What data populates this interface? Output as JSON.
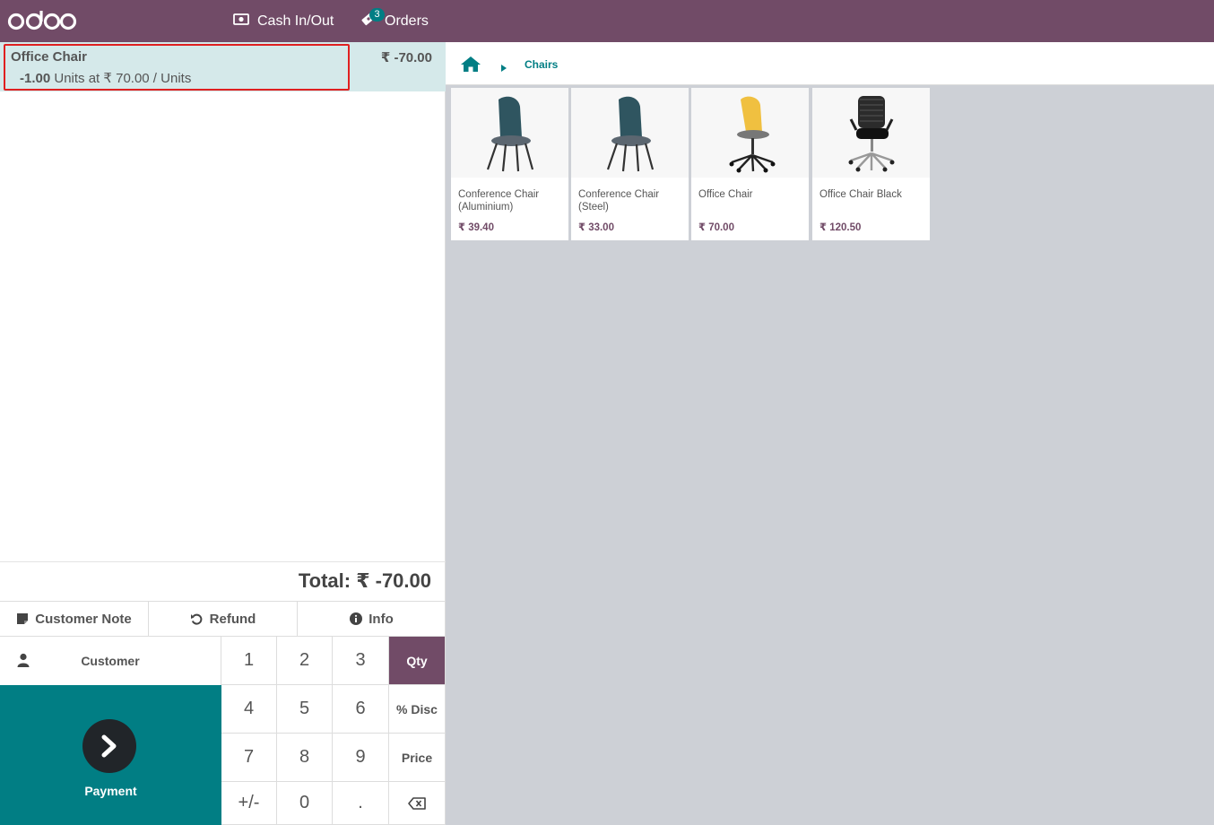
{
  "topbar": {
    "logo_text": "odoo",
    "cash_label": "Cash In/Out",
    "orders_label": "Orders",
    "orders_badge": "3"
  },
  "orderline": {
    "name": "Office Chair",
    "price": "₹ -70.00",
    "qty": "-1.00",
    "detail": "Units at ₹ 70.00 / Units"
  },
  "total": "Total: ₹ -70.00",
  "controls": {
    "customer_note": "Customer Note",
    "refund": "Refund",
    "info": "Info"
  },
  "customer_label": "Customer",
  "payment_label": "Payment",
  "numpad": {
    "k1": "1",
    "k2": "2",
    "k3": "3",
    "k4": "4",
    "k5": "5",
    "k6": "6",
    "k7": "7",
    "k8": "8",
    "k9": "9",
    "kpm": "+/-",
    "k0": "0",
    "kdot": ".",
    "qty": "Qty",
    "disc": "% Disc",
    "price": "Price"
  },
  "breadcrumb": {
    "category": "Chairs"
  },
  "products": [
    {
      "name": "Conference Chair (Aluminium)",
      "price": "₹ 39.40",
      "color": "#2f5560"
    },
    {
      "name": "Conference Chair (Steel)",
      "price": "₹ 33.00",
      "color": "#2f5560"
    },
    {
      "name": "Office Chair",
      "price": "₹ 70.00",
      "color": "#f0c040"
    },
    {
      "name": "Office Chair Black",
      "price": "₹ 120.50",
      "color": "#222222"
    }
  ],
  "colors": {
    "brand": "#714b67",
    "teal": "#017e84",
    "highlight": "#e02020",
    "selected_line": "#d5e9ea"
  }
}
